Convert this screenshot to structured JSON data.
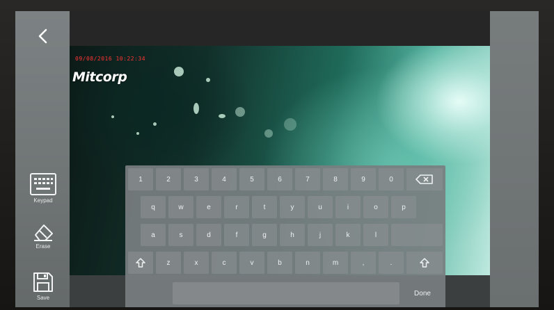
{
  "nav": {
    "back_icon": "chevron-left-icon"
  },
  "tools": {
    "keypad_label": "Keypad",
    "erase_label": "Erase",
    "save_label": "Save"
  },
  "overlay": {
    "timestamp": "09/08/2016 10:22:34",
    "logo_text": "Mitcorp"
  },
  "keyboard": {
    "row1": [
      "1",
      "2",
      "3",
      "4",
      "5",
      "6",
      "7",
      "8",
      "9",
      "0"
    ],
    "row2": [
      "q",
      "w",
      "e",
      "r",
      "t",
      "y",
      "u",
      "i",
      "o",
      "p"
    ],
    "row3": [
      "a",
      "s",
      "d",
      "f",
      "g",
      "h",
      "j",
      "k",
      "l"
    ],
    "row4": [
      "z",
      "x",
      "c",
      "v",
      "b",
      "n",
      "m",
      ",",
      "."
    ],
    "done_label": "Done"
  },
  "colors": {
    "timestamp": "#ff3434",
    "rail": "#747a7b",
    "keyboard": "#7e8486"
  }
}
